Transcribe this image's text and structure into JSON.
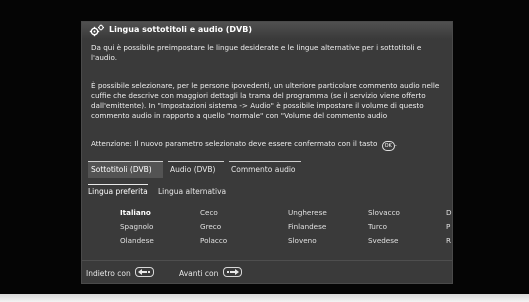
{
  "window": {
    "title": "Lingua sottotitoli e audio (DVB)",
    "icon": "settings-gears-icon"
  },
  "description": {
    "paragraph1": "Da qui è possibile preimpostare le lingue desiderate e le lingue alternative per i sottotitoli e l'audio.",
    "paragraph2": "È possibile selezionare, per le persone ipovedenti, un ulteriore particolare commento audio nelle cuffie che descrive con maggiori dettagli la trama del programma (se il servizio viene offerto dall'emittente). In \"Impostazioni sistema -> Audio\" è possibile impostare il volume di questo commento audio in rapporto a quello \"normale\" con \"Volume del commento audio",
    "note": "Attenzione: Il nuovo parametro selezionato deve essere confermato con il tasto",
    "note_end": ".",
    "ok_key_label": "OK"
  },
  "tabs": [
    {
      "label": "Sottotitoli (DVB)",
      "active": true
    },
    {
      "label": "Audio (DVB)",
      "active": false
    },
    {
      "label": "Commento audio",
      "active": false
    }
  ],
  "subtabs": [
    {
      "label": "Lingua preferita",
      "active": true
    },
    {
      "label": "Lingua alternativa",
      "active": false
    }
  ],
  "languages": [
    [
      "Italiano",
      "Ceco",
      "Ungherese",
      "Slovacco",
      "D"
    ],
    [
      "Spagnolo",
      "Greco",
      "Finlandese",
      "Turco",
      "P"
    ],
    [
      "Olandese",
      "Polacco",
      "Sloveno",
      "Svedese",
      "R"
    ]
  ],
  "selected_language": "Italiano",
  "footer": {
    "back_label": "Indietro con",
    "next_label": "Avanti con",
    "back_icon": "arrow-left-key-icon",
    "next_icon": "arrow-right-key-icon"
  },
  "colors": {
    "panel_bg": "#3a3a3a",
    "screen_bg": "#050505",
    "active_tab_bg": "#535353",
    "text": "#ffffff"
  }
}
